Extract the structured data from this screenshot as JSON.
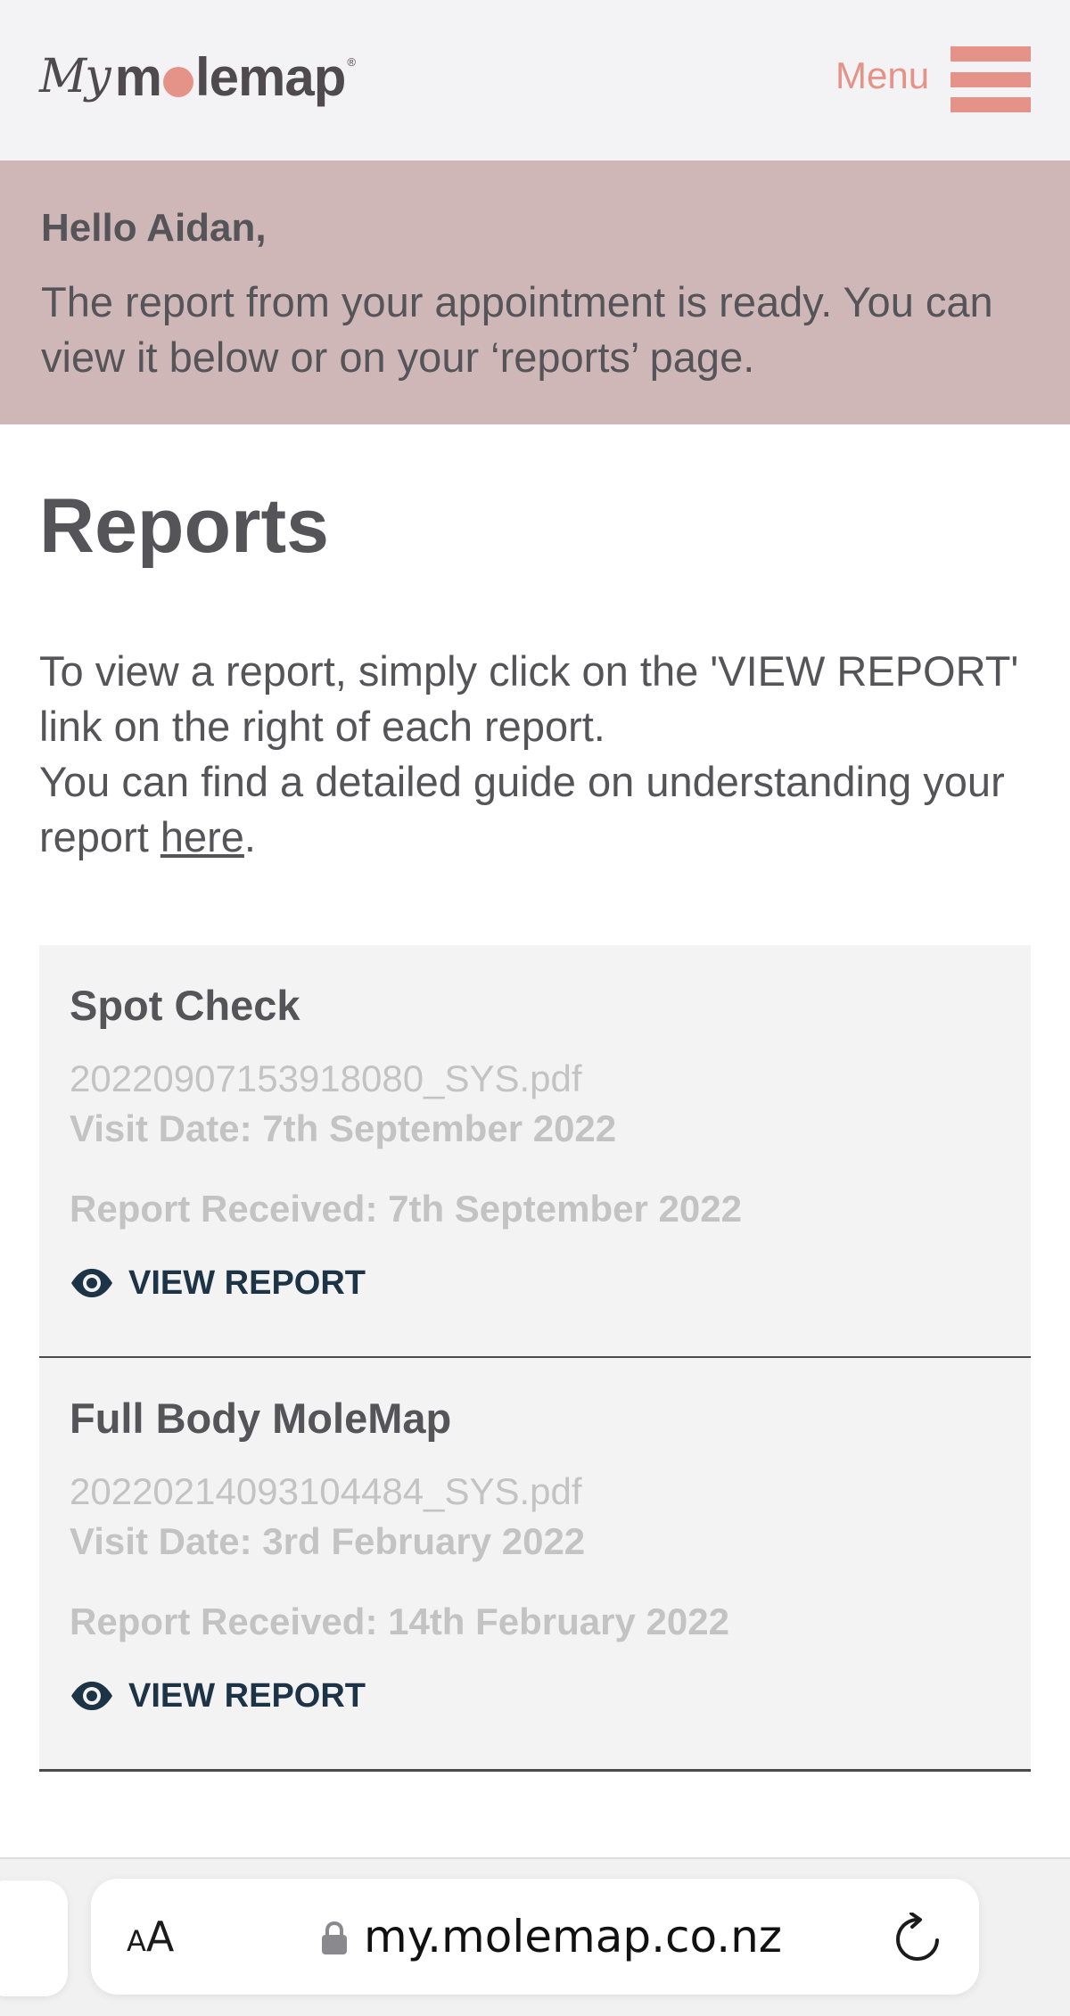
{
  "colors": {
    "accent": "#e59388",
    "banner_bg": "#cfb7b8",
    "link_dark": "#1d3346"
  },
  "header": {
    "logo_script": "My",
    "logo_word_pre": "m",
    "logo_word_post": "lemap",
    "logo_reg": "®",
    "menu_label": "Menu"
  },
  "banner": {
    "greeting": "Hello Aidan,",
    "message": "The report from your appointment is ready. You can view it below or on your ‘reports’ page."
  },
  "page": {
    "title": "Reports",
    "intro_line1": "To view a report, simply click on the 'VIEW REPORT' link on the right of each report.",
    "intro_line2_pre": "You can find a detailed guide on understanding your report ",
    "intro_link": "here",
    "intro_line2_post": "."
  },
  "reports": [
    {
      "title": "Spot Check",
      "file": "20220907153918080_SYS.pdf",
      "visit_date": "Visit Date: 7th September 2022",
      "received": "Report Received: 7th September 2022",
      "action": "VIEW REPORT",
      "action_icon": "eye-icon"
    },
    {
      "title": "Full Body MoleMap",
      "file": "20220214093104484_SYS.pdf",
      "visit_date": "Visit Date: 3rd February 2022",
      "received": "Report Received: 14th February 2022",
      "action": "VIEW REPORT",
      "action_icon": "eye-icon"
    }
  ],
  "browser": {
    "text_size_small": "A",
    "text_size_big": "A",
    "url": "my.molemap.co.nz",
    "lock_icon": "lock-icon",
    "reload_icon": "reload-icon"
  }
}
